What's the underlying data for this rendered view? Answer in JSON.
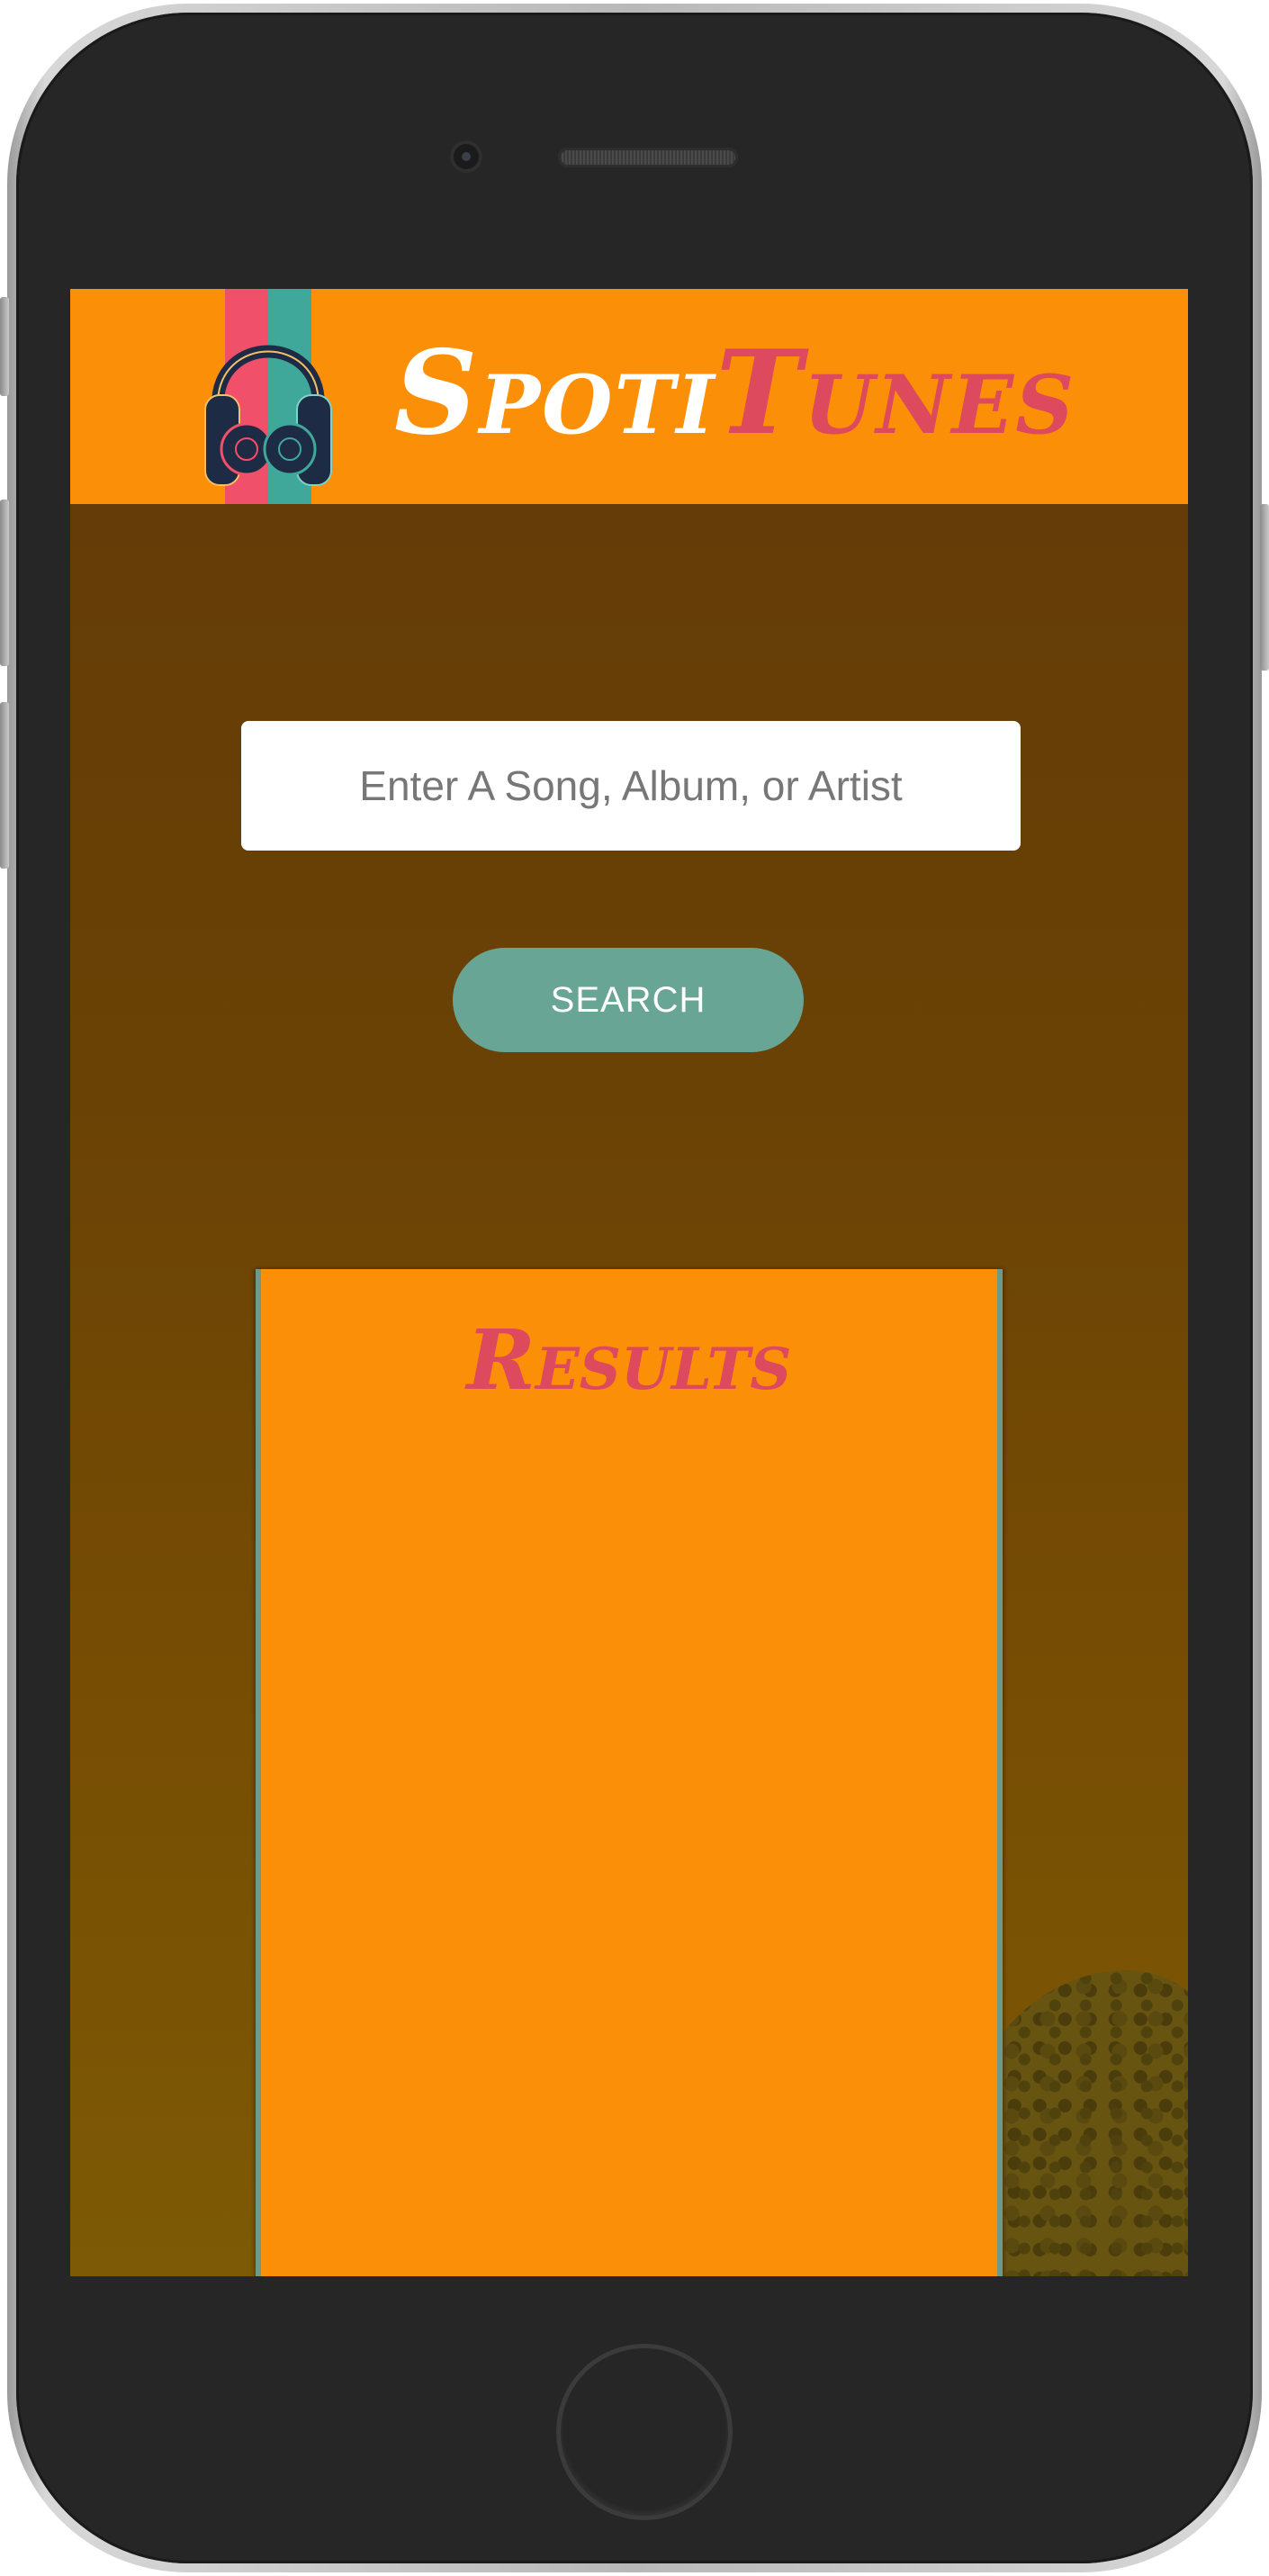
{
  "header": {
    "brand_part1": "Spoti",
    "brand_part2": "Tunes",
    "logo_icon": "headphones-icon"
  },
  "search": {
    "placeholder": "Enter A Song, Album, or Artist",
    "value": "",
    "button_label": "SEARCH"
  },
  "results": {
    "title": "Results",
    "items": []
  },
  "colors": {
    "header_bg": "#fb8f07",
    "brand_accent": "#dd4a5d",
    "button_bg": "#68a594",
    "logo_pink": "#f0506a",
    "logo_teal": "#3fa89b",
    "logo_navy": "#1e2b45"
  }
}
